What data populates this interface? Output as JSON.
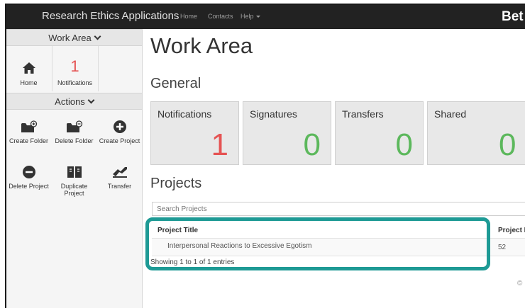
{
  "navbar": {
    "brand": "Research Ethics Applications",
    "links": [
      "Home",
      "Contacts",
      "Help"
    ],
    "beta": "Bet"
  },
  "sidebar": {
    "work_area": {
      "heading": "Work Area",
      "items": [
        {
          "label": "Home",
          "icon": "home-icon"
        },
        {
          "label": "Notifications",
          "count": "1"
        }
      ]
    },
    "actions": {
      "heading": "Actions",
      "items": [
        {
          "label": "Create Folder",
          "icon": "folder-plus-icon"
        },
        {
          "label": "Delete Folder",
          "icon": "folder-minus-icon"
        },
        {
          "label": "Create Project",
          "icon": "plus-circle-icon"
        },
        {
          "label": "Delete Project",
          "icon": "minus-circle-icon"
        },
        {
          "label": "Duplicate Project",
          "icon": "duplicate-icon"
        },
        {
          "label": "Transfer",
          "icon": "transfer-icon"
        }
      ]
    }
  },
  "main": {
    "title": "Work Area",
    "general_heading": "General",
    "cards": [
      {
        "title": "Notifications",
        "count": "1",
        "color": "#e55353"
      },
      {
        "title": "Signatures",
        "count": "0",
        "color": "#5cb85c"
      },
      {
        "title": "Transfers",
        "count": "0",
        "color": "#5cb85c"
      },
      {
        "title": "Shared",
        "count": "0",
        "color": "#5cb85c"
      }
    ],
    "projects_heading": "Projects",
    "search_placeholder": "Search Projects",
    "table": {
      "columns": [
        "Project Title",
        "Project I"
      ],
      "rows": [
        {
          "title": "Interpersonal Reactions to Excessive Egotism",
          "id": "52"
        }
      ],
      "info": "Showing 1 to 1 of 1 entries"
    },
    "footer_partial": "©"
  },
  "colors": {
    "navbar": "#222222",
    "callout": "#1e9a95",
    "notification_red": "#e55353",
    "count_green": "#5cb85c"
  }
}
